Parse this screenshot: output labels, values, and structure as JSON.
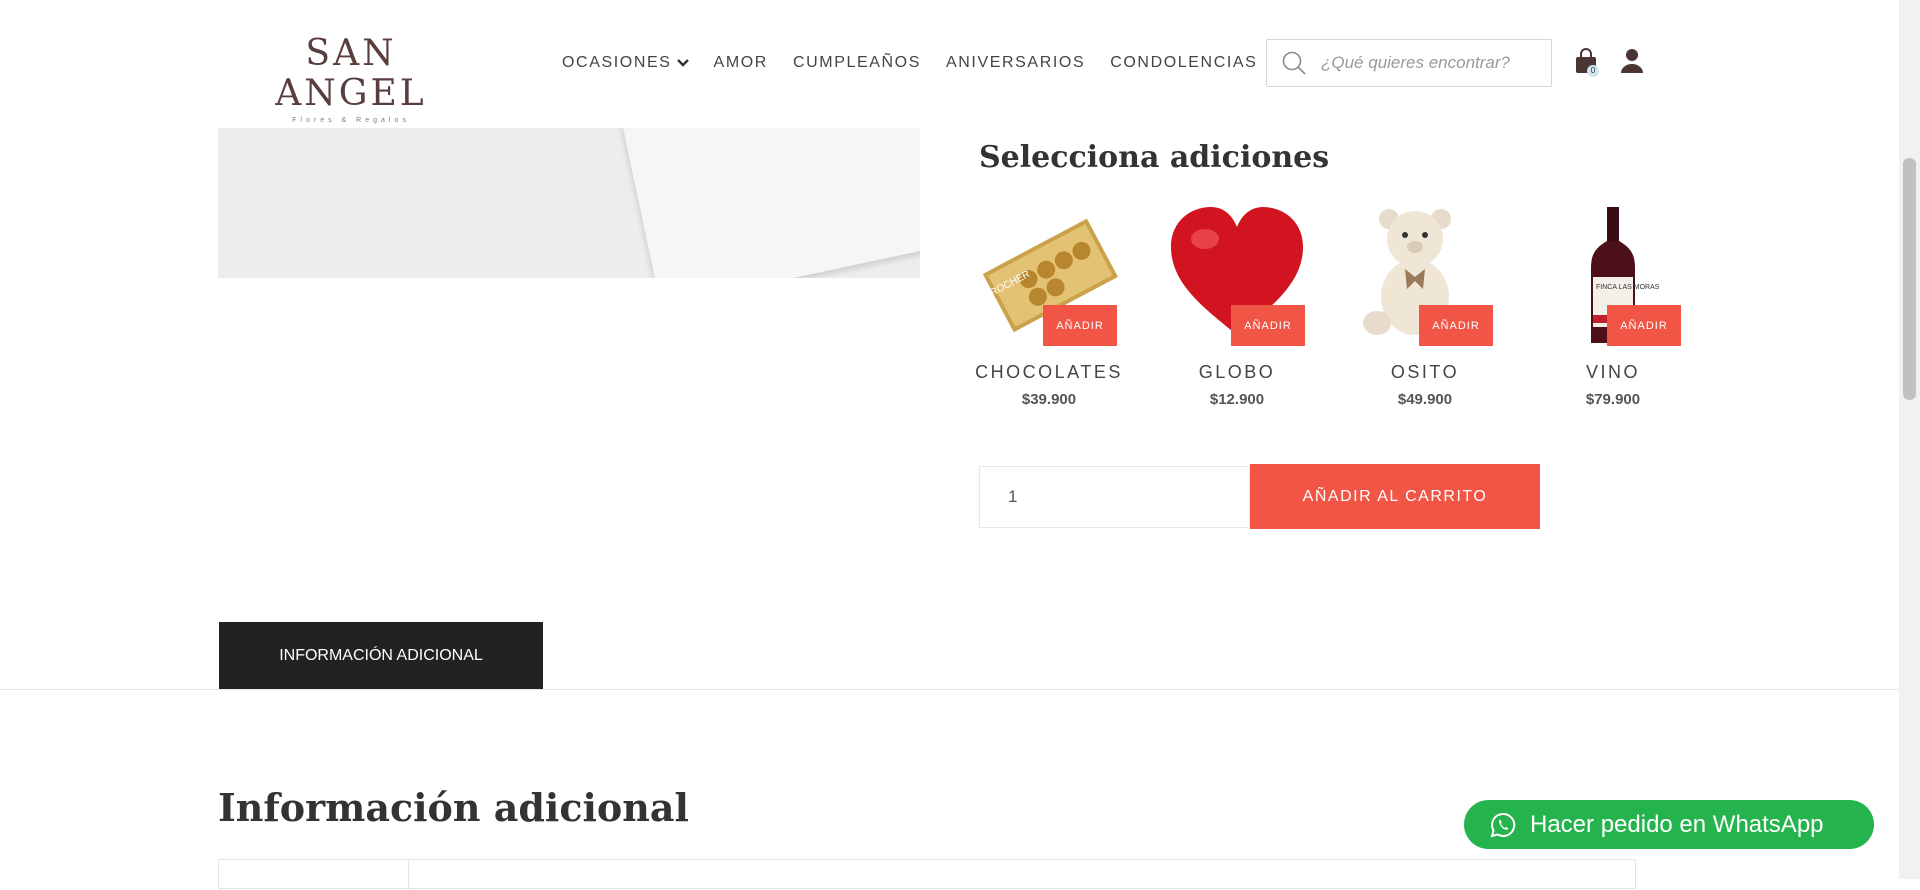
{
  "header": {
    "logo": {
      "main": "SAN ANGEL",
      "sub": "Flores & Regalos"
    },
    "nav": [
      {
        "label": "OCASIONES",
        "has_dropdown": true
      },
      {
        "label": "AMOR"
      },
      {
        "label": "CUMPLEAÑOS"
      },
      {
        "label": "ANIVERSARIOS"
      },
      {
        "label": "CONDOLENCIAS"
      }
    ],
    "search": {
      "placeholder": "¿Qué quieres encontrar?"
    },
    "cart_count": "0",
    "icons": [
      "search-icon",
      "cart-icon",
      "user-icon",
      "chevron-down-icon"
    ]
  },
  "additions": {
    "title": "Selecciona adiciones",
    "button_label": "AÑADIR",
    "items": [
      {
        "name": "CHOCOLATES",
        "price": "$39.900",
        "label": "ROCHER"
      },
      {
        "name": "GLOBO",
        "price": "$12.900"
      },
      {
        "name": "OSITO",
        "price": "$49.900"
      },
      {
        "name": "VINO",
        "price": "$79.900",
        "label": "FINCA LAS MORAS"
      }
    ]
  },
  "purchase": {
    "quantity": "1",
    "add_to_cart_label": "AÑADIR AL CARRITO"
  },
  "tabs": {
    "active": "INFORMACIÓN ADICIONAL"
  },
  "info": {
    "heading": "Información adicional"
  },
  "whatsapp": {
    "label": "Hacer pedido en WhatsApp"
  },
  "colors": {
    "accent": "#f05545",
    "whatsapp": "#25b34e",
    "tab_bg": "#222222",
    "logo": "#5a3d3d"
  }
}
